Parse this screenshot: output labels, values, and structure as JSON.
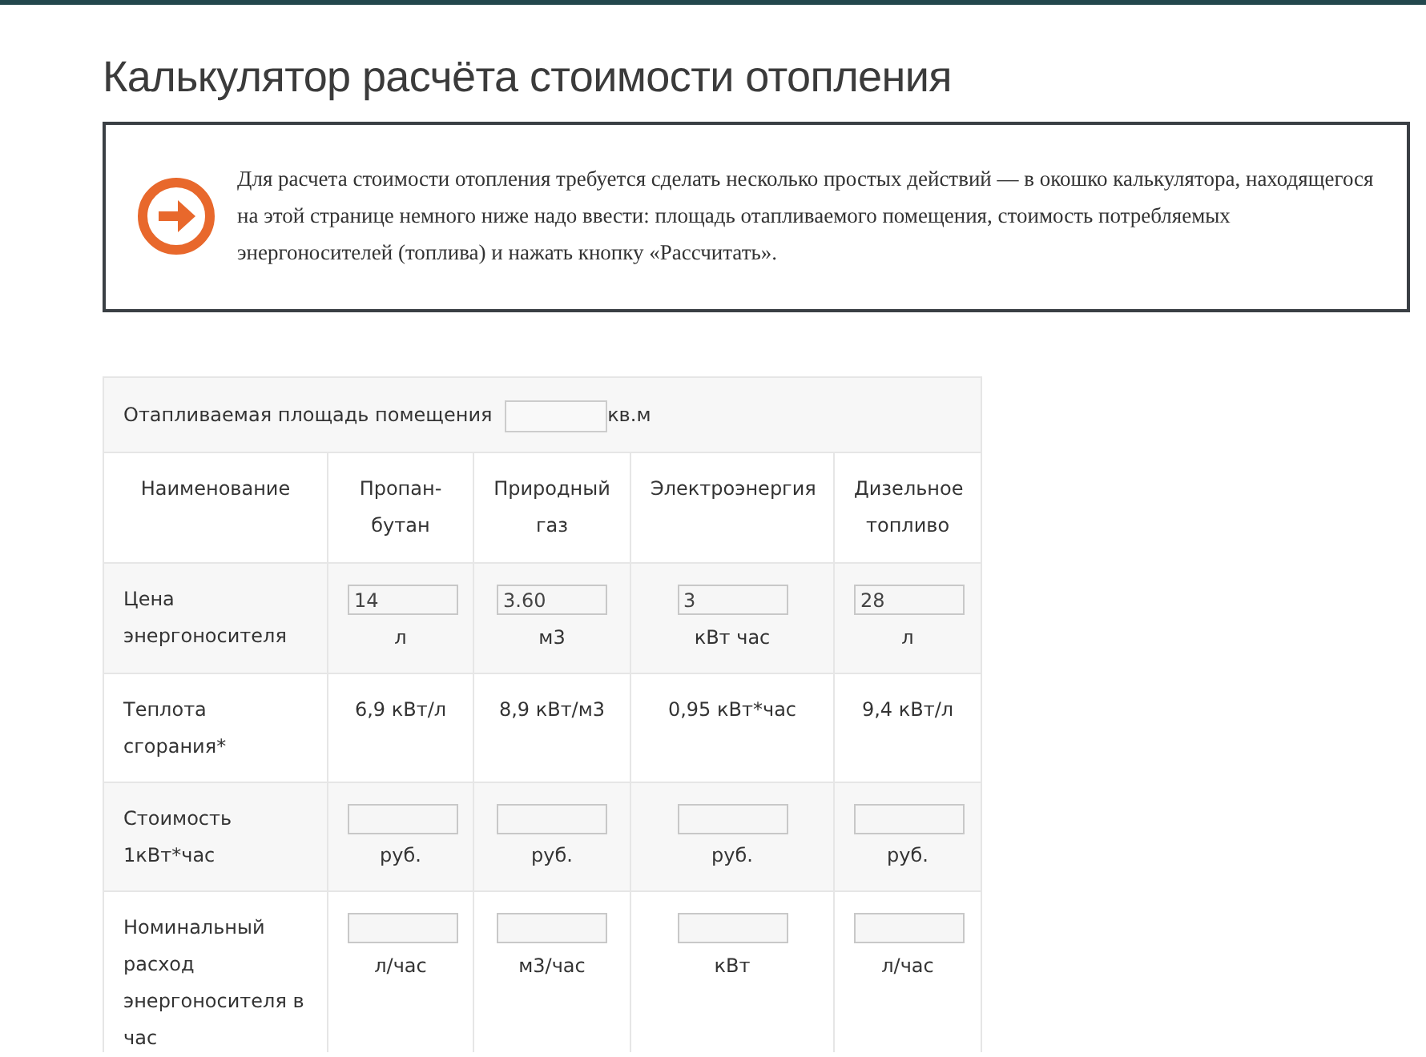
{
  "title": "Калькулятор расчёта стоимости отопления",
  "notice": {
    "text": "Для расчета стоимости отопления требуется сделать несколько простых действий — в окошко калькулятора, находящегося на этой странице немного ниже надо ввести: площадь отапливаемого помещения, стоимость потребляемых энергоносителей (топлива) и нажать кнопку «Рассчитать»."
  },
  "area": {
    "label": "Отапливаемая площадь помещения",
    "unit": "кв.м"
  },
  "columns": [
    "Наименование",
    "Пропан-бутан",
    "Природный газ",
    "Электроэнергия",
    "Дизельное топливо"
  ],
  "rows": [
    {
      "kind": "inputs",
      "label": "Цена энергоносителя",
      "cells": [
        {
          "value": "14",
          "unit": "л"
        },
        {
          "value": "3.60",
          "unit": "м3"
        },
        {
          "value": "3",
          "unit": "кВт час"
        },
        {
          "value": "28",
          "unit": "л"
        }
      ]
    },
    {
      "kind": "text",
      "label": "Теплота сгорания*",
      "cells": [
        {
          "text": "6,9 кВт/л"
        },
        {
          "text": "8,9 кВт/м3"
        },
        {
          "text": "0,95 кВт*час"
        },
        {
          "text": "9,4 кВт/л"
        }
      ]
    },
    {
      "kind": "inputs",
      "label": "Стоимость 1кВт*час",
      "cells": [
        {
          "unit": "руб."
        },
        {
          "unit": "руб."
        },
        {
          "unit": "руб."
        },
        {
          "unit": "руб."
        }
      ]
    },
    {
      "kind": "inputs",
      "label": "Номинальный расход энергоносителя в час",
      "cells": [
        {
          "unit": "л/час"
        },
        {
          "unit": "м3/час"
        },
        {
          "unit": "кВт"
        },
        {
          "unit": "л/час"
        }
      ]
    }
  ]
}
